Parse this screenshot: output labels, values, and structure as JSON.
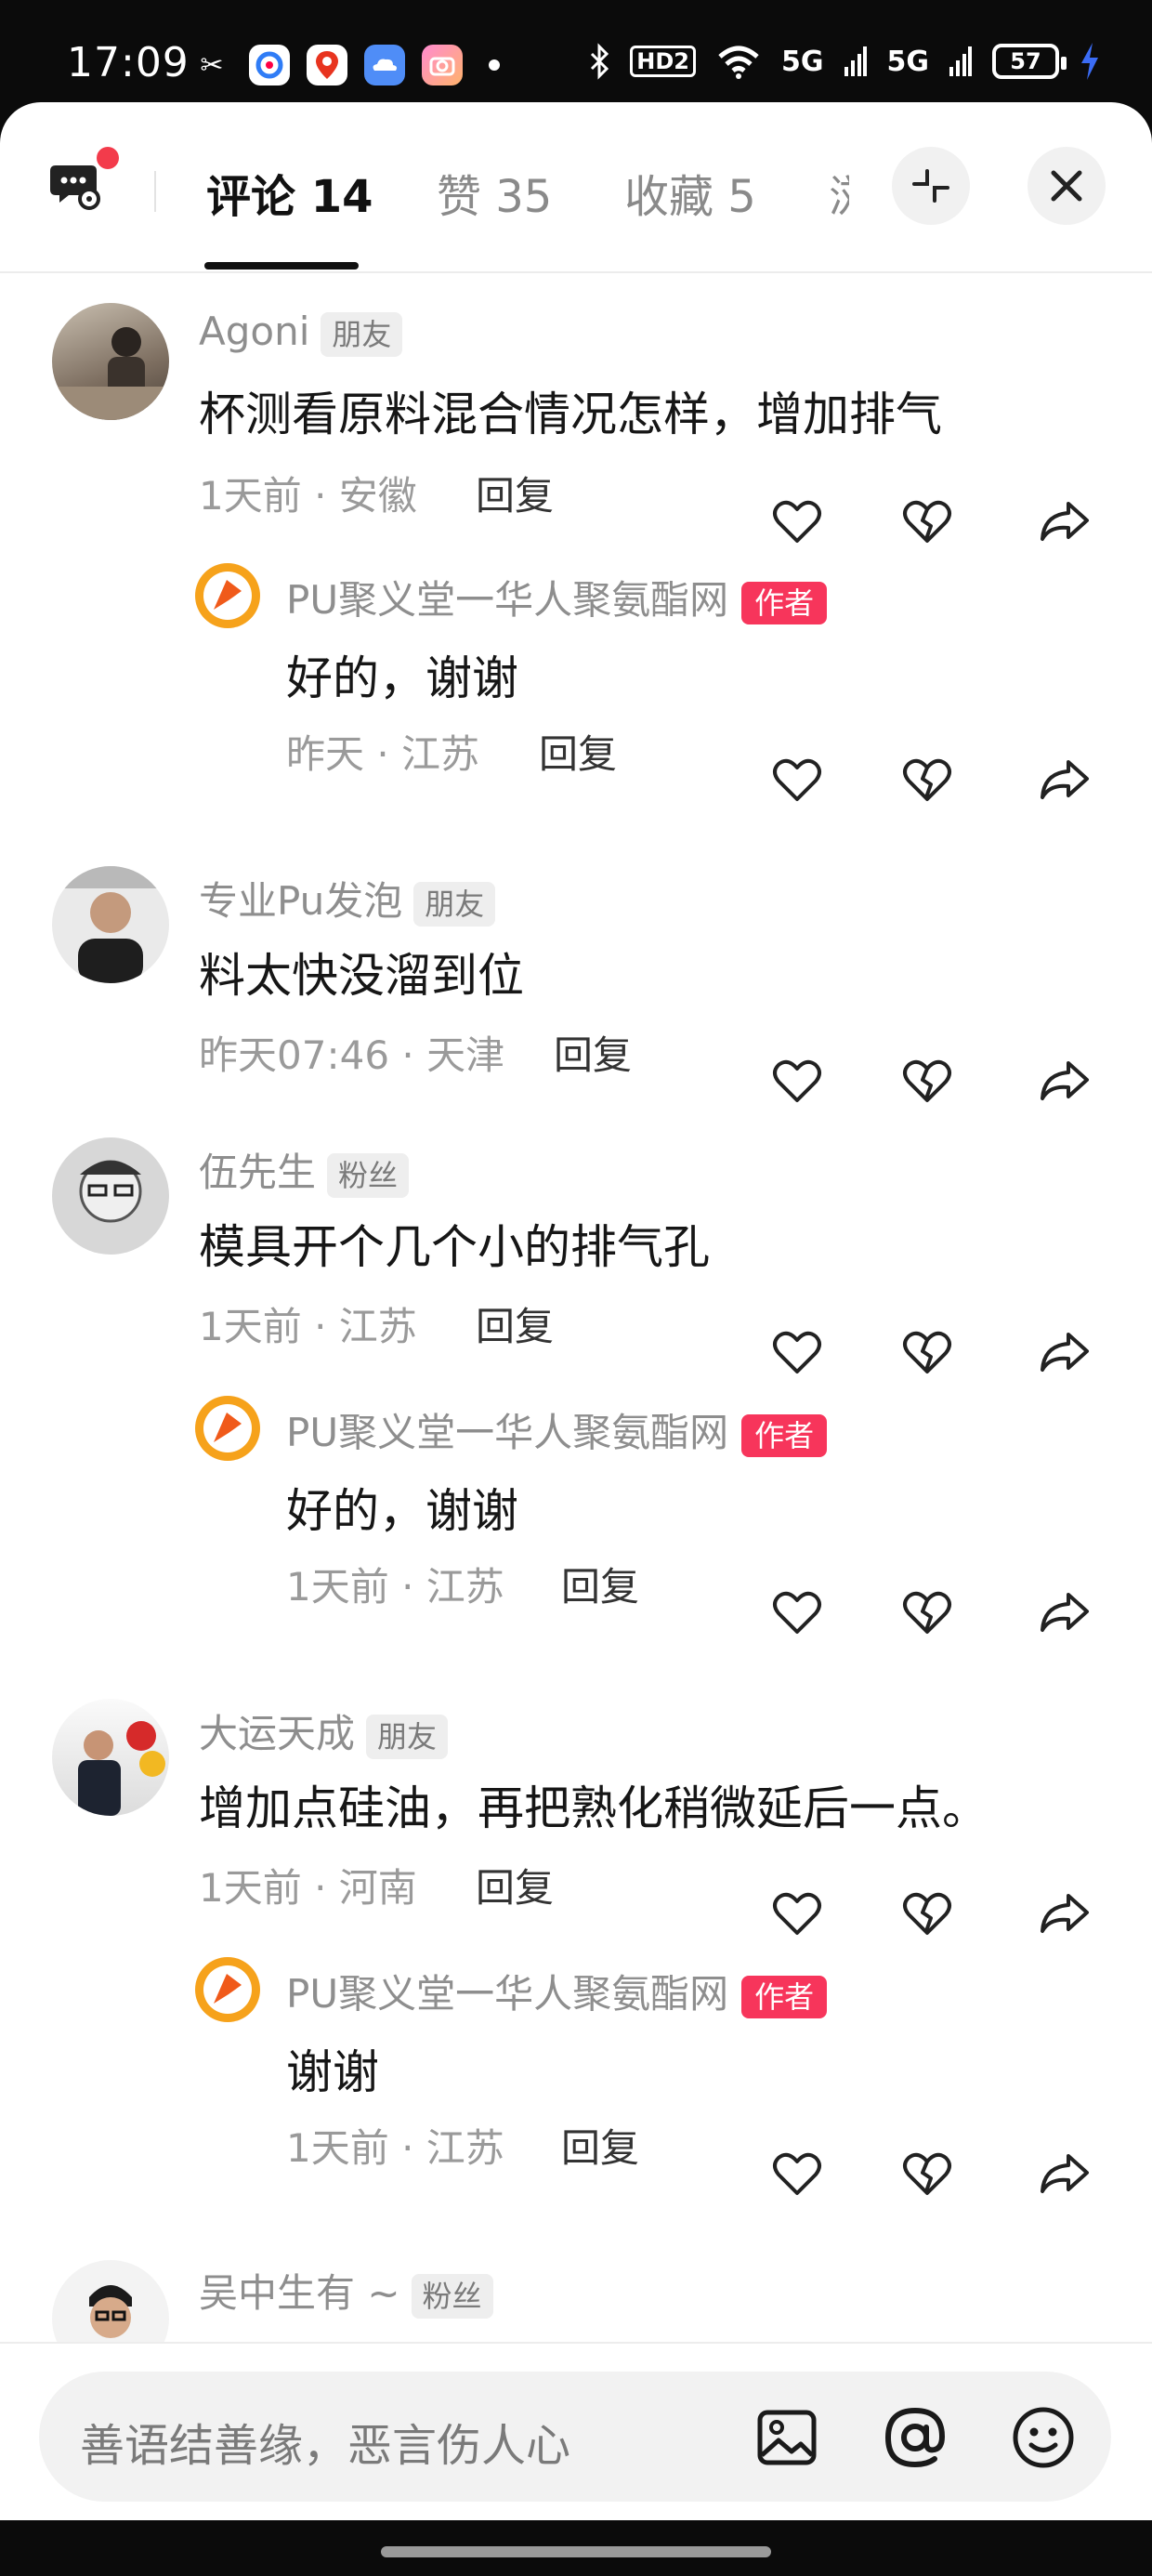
{
  "status_bar": {
    "time": "17:09",
    "network_labels": [
      "HD2",
      "5G",
      "5G"
    ],
    "battery": "57",
    "icons": [
      "capcut-icon",
      "browser-icon",
      "baidu-map-icon",
      "cloud-icon",
      "camera-icon",
      "bluetooth-icon",
      "wifi-icon",
      "charging-icon"
    ]
  },
  "tabs": [
    {
      "label": "评论 14",
      "active": true
    },
    {
      "label": "赞 35",
      "active": false
    },
    {
      "label": "收藏 5",
      "active": false
    },
    {
      "label": "浏",
      "active": false
    }
  ],
  "comments": [
    {
      "user": "Agoni",
      "badge": "朋友",
      "text": "杯测看原料混合情况怎样，增加排气",
      "meta": "1天前 · 安徽",
      "reply_label": "回复",
      "reply": {
        "user": "PU聚义堂一华人聚氨酯网",
        "badge": "作者",
        "text": "好的，谢谢",
        "meta": "昨天 · 江苏",
        "reply_label": "回复"
      }
    },
    {
      "user": "专业Pu发泡",
      "badge": "朋友",
      "text": "料太快没溜到位",
      "meta": "昨天07:46 · 天津",
      "reply_label": "回复"
    },
    {
      "user": "伍先生",
      "badge": "粉丝",
      "text": "模具开个几个小的排气孔",
      "meta": "1天前 · 江苏",
      "reply_label": "回复",
      "reply": {
        "user": "PU聚义堂一华人聚氨酯网",
        "badge": "作者",
        "text": "好的，谢谢",
        "meta": "1天前 · 江苏",
        "reply_label": "回复"
      }
    },
    {
      "user": "大运天成",
      "badge": "朋友",
      "text": "增加点硅油，再把熟化稍微延后一点。",
      "meta": "1天前 · 河南",
      "reply_label": "回复",
      "reply": {
        "user": "PU聚义堂一华人聚氨酯网",
        "badge": "作者",
        "text": "谢谢",
        "meta": "1天前 · 江苏",
        "reply_label": "回复"
      }
    },
    {
      "user": "吴中生有 ~",
      "badge": "粉丝"
    }
  ],
  "input": {
    "placeholder": "善语结善缘，恶言伤人心"
  }
}
